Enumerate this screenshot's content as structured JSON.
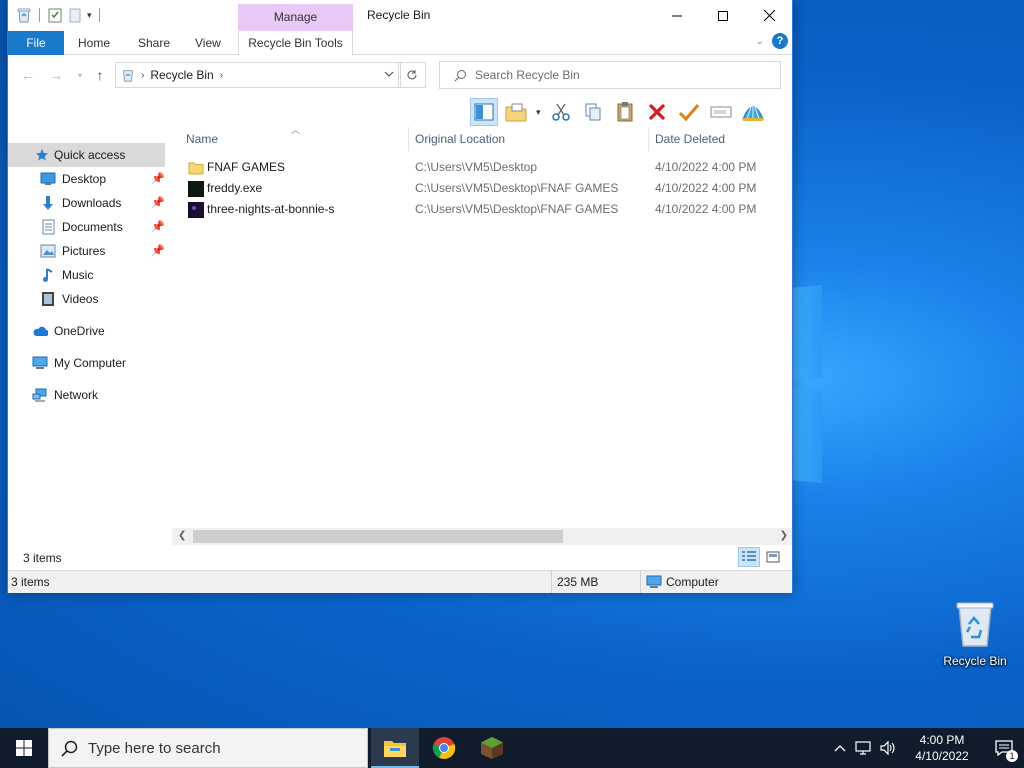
{
  "desktop": {
    "icons": [
      {
        "label": "Recycle Bin",
        "icon": "recycle-bin-icon"
      }
    ]
  },
  "explorer": {
    "title": "Recycle Bin",
    "contextual_group": "Manage",
    "ribbon_tabs": {
      "file": "File",
      "home": "Home",
      "share": "Share",
      "view": "View",
      "tools": "Recycle Bin Tools"
    },
    "address": {
      "location": "Recycle Bin"
    },
    "search": {
      "placeholder": "Search Recycle Bin"
    },
    "nav_pane": {
      "quick_access": "Quick access",
      "items": [
        {
          "label": "Desktop",
          "icon": "desktop-icon",
          "pinned": true
        },
        {
          "label": "Downloads",
          "icon": "downloads-icon",
          "pinned": true
        },
        {
          "label": "Documents",
          "icon": "documents-icon",
          "pinned": true
        },
        {
          "label": "Pictures",
          "icon": "pictures-icon",
          "pinned": true
        },
        {
          "label": "Music",
          "icon": "music-icon",
          "pinned": false
        },
        {
          "label": "Videos",
          "icon": "videos-icon",
          "pinned": false
        }
      ],
      "onedrive": "OneDrive",
      "my_computer": "My Computer",
      "network": "Network"
    },
    "columns": {
      "name": "Name",
      "original_location": "Original Location",
      "date_deleted": "Date Deleted"
    },
    "files": [
      {
        "name": "FNAF GAMES",
        "type": "folder",
        "original_location": "C:\\Users\\VM5\\Desktop",
        "date_deleted": "4/10/2022 4:00 PM"
      },
      {
        "name": "freddy.exe",
        "type": "exe",
        "original_location": "C:\\Users\\VM5\\Desktop\\FNAF GAMES",
        "date_deleted": "4/10/2022 4:00 PM"
      },
      {
        "name": "three-nights-at-bonnie-s",
        "type": "app",
        "original_location": "C:\\Users\\VM5\\Desktop\\FNAF GAMES",
        "date_deleted": "4/10/2022 4:00 PM"
      }
    ],
    "item_count": "3 items",
    "status": {
      "items": "3 items",
      "size": "235 MB",
      "location": "Computer"
    }
  },
  "taskbar": {
    "search_placeholder": "Type here to search",
    "clock_time": "4:00 PM",
    "clock_date": "4/10/2022",
    "notification_count": "1"
  },
  "colors": {
    "accent": "#1979ca",
    "manage_tab": "#e8c9f7",
    "taskbar": "#101b2b",
    "selection": "#cce4f7"
  }
}
